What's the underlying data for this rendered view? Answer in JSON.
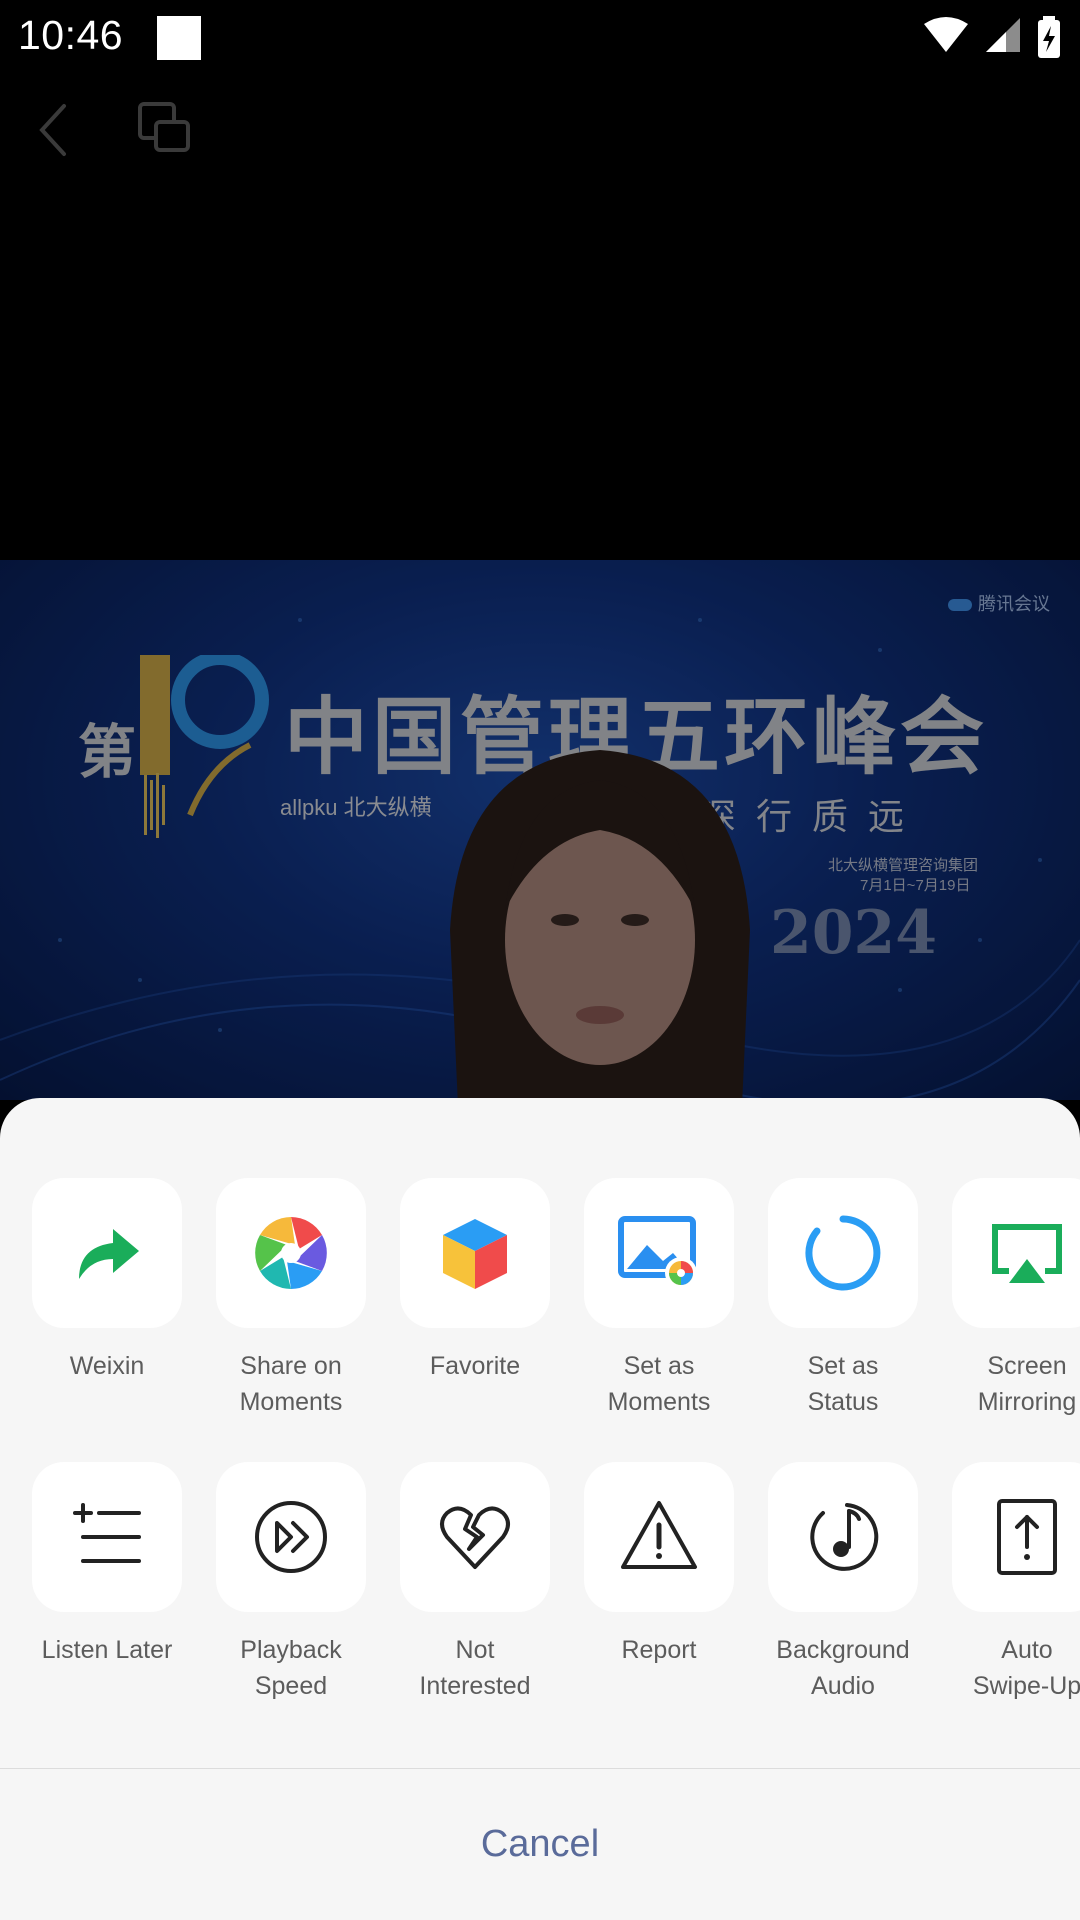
{
  "status_bar": {
    "time": "10:46",
    "icons": [
      "wifi-icon",
      "cell-signal-icon",
      "battery-charging-icon"
    ]
  },
  "toolbar": {
    "back_icon": "chevron-left-icon",
    "pip_icon": "picture-in-picture-icon"
  },
  "video": {
    "brand": "腾讯会议",
    "banner_prefix": "第",
    "banner_title": "中国管理五环峰会",
    "logo_text": "allpku 北大纵横",
    "tagline": "深行质远",
    "org": "北大纵横管理咨询集团",
    "dates": "7月1日~7月19日",
    "year": "2024"
  },
  "share_sheet": {
    "row1": [
      {
        "label": "Weixin",
        "icon": "forward-arrow-icon"
      },
      {
        "label": "Share on\nMoments",
        "icon": "moments-aperture-icon"
      },
      {
        "label": "Favorite",
        "icon": "favorite-cube-icon"
      },
      {
        "label": "Set as\nMoments",
        "icon": "image-moments-icon"
      },
      {
        "label": "Set as\nStatus",
        "icon": "status-ring-icon"
      },
      {
        "label": "Screen\nMirroring",
        "icon": "screen-mirroring-icon"
      }
    ],
    "row2": [
      {
        "label": "Listen Later",
        "icon": "add-to-list-icon"
      },
      {
        "label": "Playback\nSpeed",
        "icon": "fast-forward-icon"
      },
      {
        "label": "Not\nInterested",
        "icon": "broken-heart-icon"
      },
      {
        "label": "Report",
        "icon": "warning-triangle-icon"
      },
      {
        "label": "Background\nAudio",
        "icon": "music-note-icon"
      },
      {
        "label": "Auto\nSwipe-Up",
        "icon": "swipe-up-icon"
      }
    ],
    "cancel_label": "Cancel"
  },
  "colors": {
    "weixin_green": "#1aad5a",
    "status_blue": "#2a9df4",
    "cancel_text": "#5a6b9a",
    "sheet_bg": "#f6f6f6"
  }
}
